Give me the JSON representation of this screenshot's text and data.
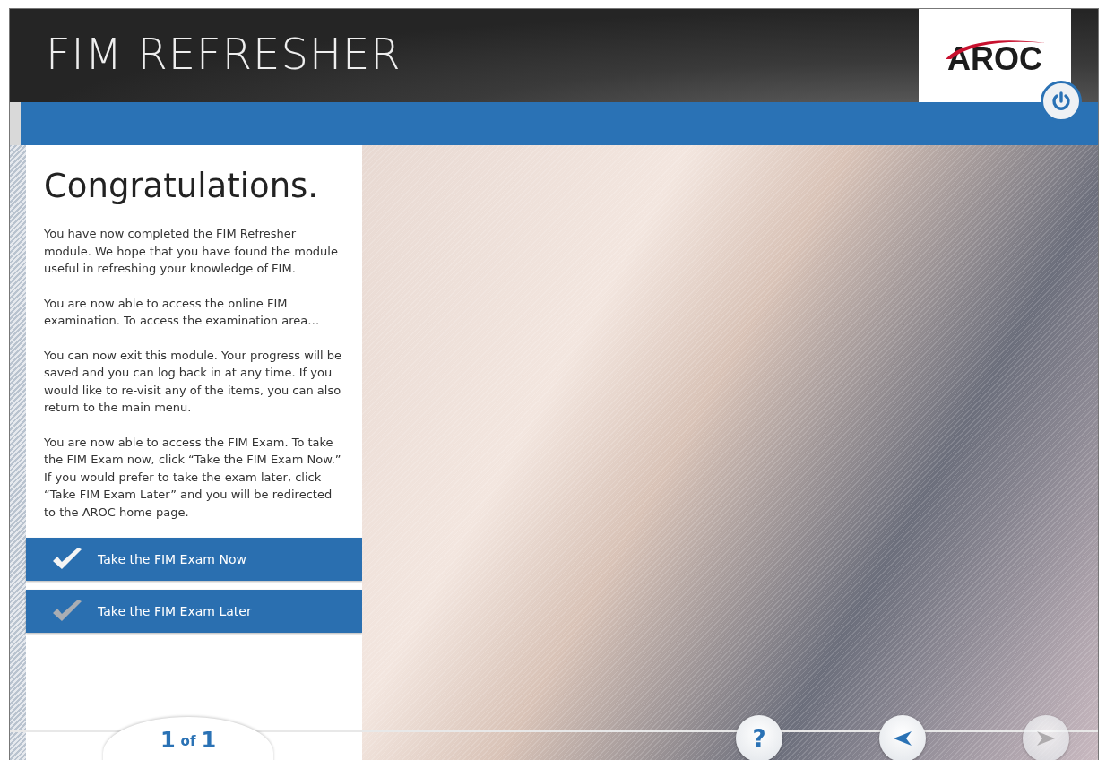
{
  "header": {
    "title": "FIM REFRESHER",
    "logo": "AROC"
  },
  "content": {
    "heading": "Congratulations.",
    "paragraphs": [
      "You have now completed the FIM Refresher module. We hope that you have found the module useful in refreshing your knowledge of FIM.",
      "You are now able to access the online FIM examination. To access the examination area…",
      "You can now exit this module. Your progress will be saved and you can log back in at any time. If you would like to re-visit any of the items, you can also return to the main menu.",
      "You are now able to access the FIM Exam. To take the FIM Exam now, click “Take the FIM Exam Now.” If you would prefer to take the exam later, click “Take FIM Exam Later” and you will be redirected to the AROC home page."
    ],
    "options": [
      {
        "label": "Take the FIM Exam Now",
        "checked": true
      },
      {
        "label": "Take the FIM Exam Later",
        "checked": false
      }
    ]
  },
  "pager": {
    "current": "1",
    "separator": "of",
    "total": "1"
  },
  "nav": {
    "help": "?",
    "prev_disabled": false,
    "next_disabled": true
  }
}
